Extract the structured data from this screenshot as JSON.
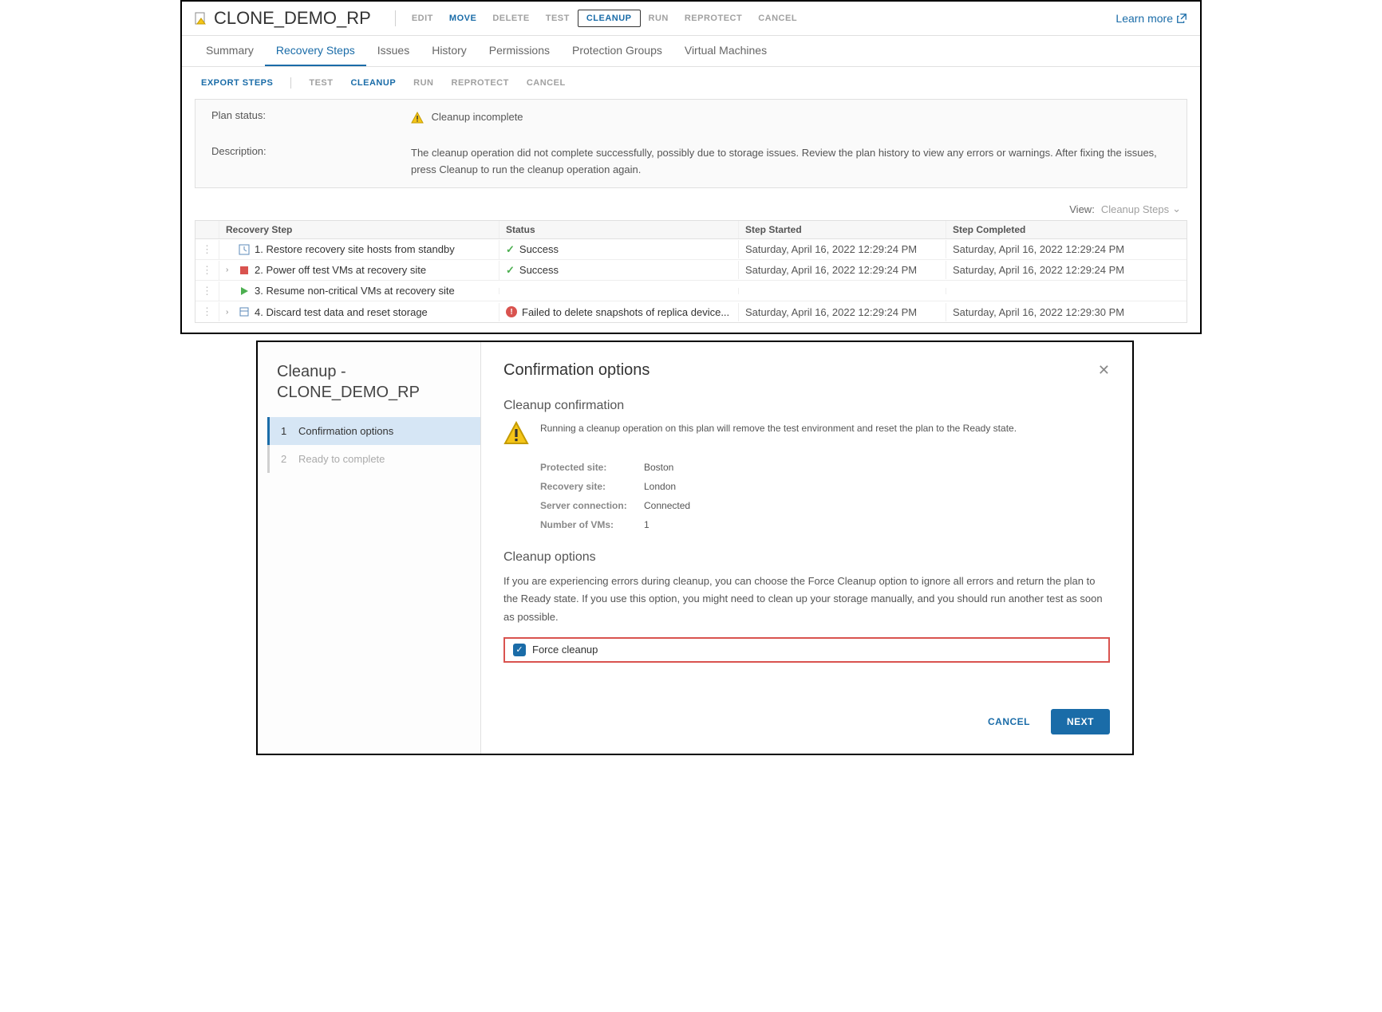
{
  "header": {
    "title": "CLONE_DEMO_RP",
    "actions": {
      "edit": "EDIT",
      "move": "MOVE",
      "delete": "DELETE",
      "test": "TEST",
      "cleanup": "CLEANUP",
      "run": "RUN",
      "reprotect": "REPROTECT",
      "cancel": "CANCEL"
    },
    "learn_more": "Learn more"
  },
  "tabs": {
    "summary": "Summary",
    "recovery_steps": "Recovery Steps",
    "issues": "Issues",
    "history": "History",
    "permissions": "Permissions",
    "protection_groups": "Protection Groups",
    "virtual_machines": "Virtual Machines"
  },
  "subbar": {
    "export": "EXPORT STEPS",
    "test": "TEST",
    "cleanup": "CLEANUP",
    "run": "RUN",
    "reprotect": "REPROTECT",
    "cancel": "CANCEL"
  },
  "status": {
    "plan_status_label": "Plan status:",
    "plan_status_value": "Cleanup incomplete",
    "description_label": "Description:",
    "description_value": "The cleanup operation did not complete successfully, possibly due to storage issues. Review the plan history to view any errors or warnings. After fixing the issues, press Cleanup to run the cleanup operation again."
  },
  "view": {
    "label": "View:",
    "selected": "Cleanup Steps"
  },
  "table": {
    "headers": {
      "step": "Recovery Step",
      "status": "Status",
      "started": "Step Started",
      "completed": "Step Completed"
    },
    "rows": [
      {
        "expand": false,
        "icon": "restore",
        "label": "1. Restore recovery site hosts from standby",
        "status_icon": "success",
        "status_text": "Success",
        "started": "Saturday, April 16, 2022 12:29:24 PM",
        "completed": "Saturday, April 16, 2022 12:29:24 PM"
      },
      {
        "expand": true,
        "icon": "red",
        "label": "2. Power off test VMs at recovery site",
        "status_icon": "success",
        "status_text": "Success",
        "started": "Saturday, April 16, 2022 12:29:24 PM",
        "completed": "Saturday, April 16, 2022 12:29:24 PM"
      },
      {
        "expand": false,
        "icon": "play",
        "label": "3. Resume non-critical VMs at recovery site",
        "status_icon": "",
        "status_text": "",
        "started": "",
        "completed": ""
      },
      {
        "expand": true,
        "icon": "disk",
        "label": "4. Discard test data and reset storage",
        "status_icon": "error",
        "status_text": "Failed to delete snapshots of replica device...",
        "started": "Saturday, April 16, 2022 12:29:24 PM",
        "completed": "Saturday, April 16, 2022 12:29:30 PM"
      }
    ]
  },
  "modal": {
    "left_title": "Cleanup - CLONE_DEMO_RP",
    "wizard": {
      "step1_num": "1",
      "step1": "Confirmation options",
      "step2_num": "2",
      "step2": "Ready to complete"
    },
    "right_title": "Confirmation options",
    "confirmation": {
      "heading": "Cleanup confirmation",
      "text": "Running a cleanup operation on this plan will remove the test environment and reset the plan to the Ready state.",
      "protected_label": "Protected site:",
      "protected_value": "Boston",
      "recovery_label": "Recovery site:",
      "recovery_value": "London",
      "server_label": "Server connection:",
      "server_value": "Connected",
      "vms_label": "Number of VMs:",
      "vms_value": "1"
    },
    "options": {
      "heading": "Cleanup options",
      "text": "If you are experiencing errors during cleanup, you can choose the Force Cleanup option to ignore all errors and return the plan to the Ready state. If you use this option, you might need to clean up your storage manually, and you should run another test as soon as possible.",
      "force_label": "Force cleanup"
    },
    "footer": {
      "cancel": "CANCEL",
      "next": "NEXT"
    }
  }
}
